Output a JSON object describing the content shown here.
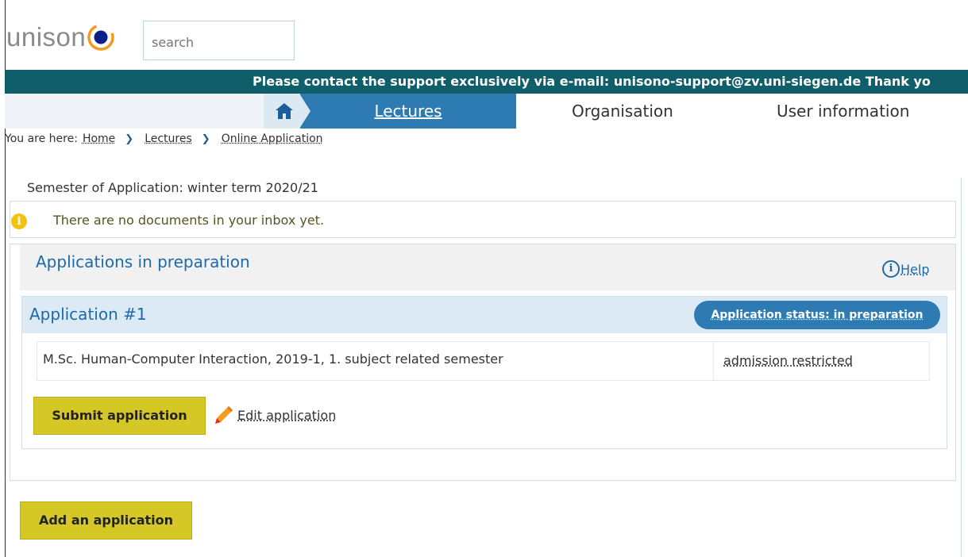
{
  "header": {
    "logo_text": "unison",
    "search_placeholder": "search"
  },
  "banner": {
    "text": "Please contact the support exclusively via e-mail: unisono-support@zv.uni-siegen.de Thank yo"
  },
  "nav": {
    "home_icon": "home-icon",
    "items": [
      {
        "label": "Lectures",
        "active": true
      },
      {
        "label": "Organisation",
        "active": false
      },
      {
        "label": "User information",
        "active": false
      }
    ]
  },
  "breadcrumb": {
    "prefix": "You are here:",
    "items": [
      "Home",
      "Lectures",
      "Online Application"
    ]
  },
  "semester_text": "Semester of Application: winter term 2020/21",
  "info_message": "There are no documents in your inbox yet.",
  "applications": {
    "title": "Applications in preparation",
    "help_label": "Help",
    "application": {
      "title": "Application #1",
      "status": "Application status: in preparation",
      "course": "M.Sc. Human-Computer Interaction, 2019-1, 1. subject related semester",
      "restriction": "admission restricted",
      "submit_label": "Submit application",
      "edit_label": "Edit application"
    }
  },
  "add_label": "Add an application",
  "colors": {
    "banner": "#0f5e6a",
    "nav_active": "#2e7bb4",
    "button": "#d4c726",
    "heading": "#1e6aa8",
    "info": "#f3c20f"
  }
}
